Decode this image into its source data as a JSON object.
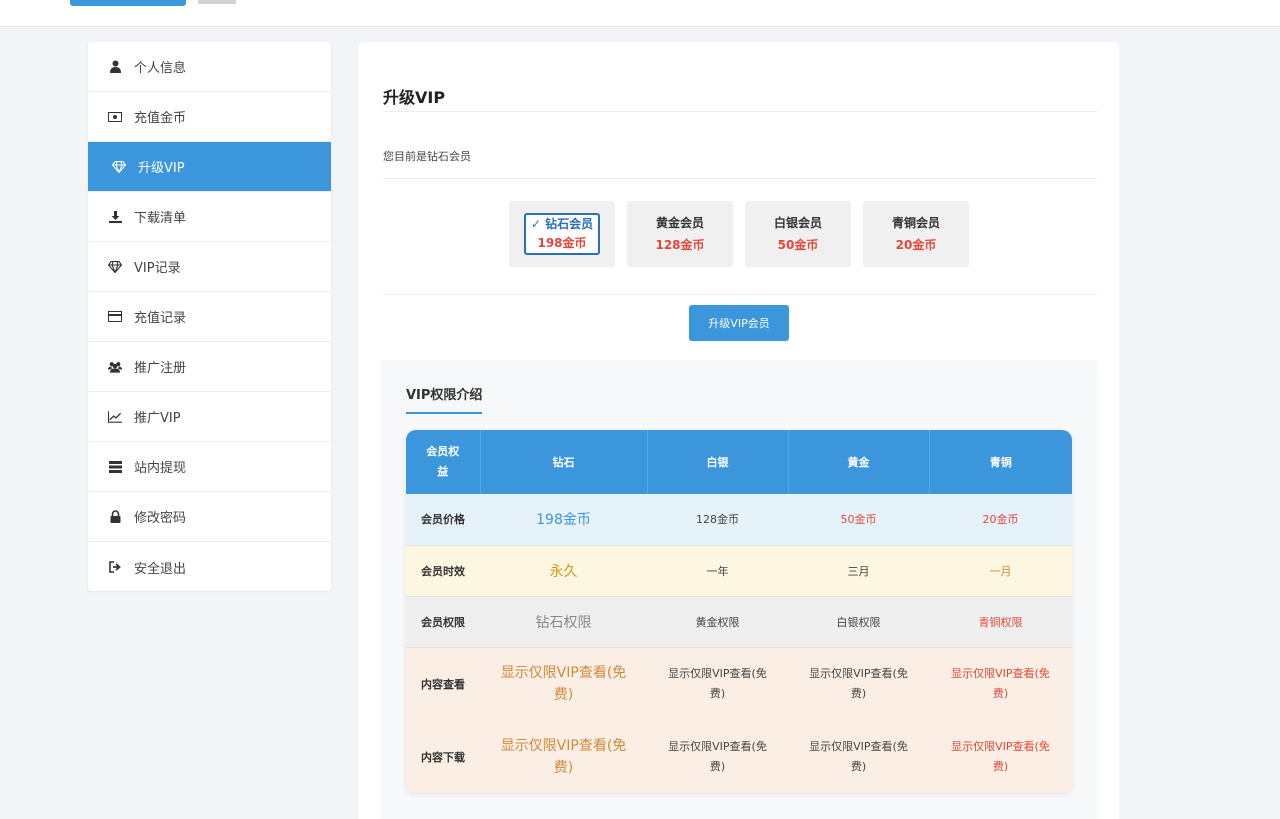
{
  "sidebar": {
    "items": [
      {
        "label": "个人信息",
        "icon": "user-icon",
        "active": false
      },
      {
        "label": "充值金币",
        "icon": "money-icon",
        "active": false
      },
      {
        "label": "升级VIP",
        "icon": "diamond-icon",
        "active": true
      },
      {
        "label": "下载清单",
        "icon": "download-icon",
        "active": false
      },
      {
        "label": "VIP记录",
        "icon": "diamond-icon",
        "active": false
      },
      {
        "label": "充值记录",
        "icon": "credit-card-icon",
        "active": false
      },
      {
        "label": "推广注册",
        "icon": "users-icon",
        "active": false
      },
      {
        "label": "推广VIP",
        "icon": "line-chart-icon",
        "active": false
      },
      {
        "label": "站内提现",
        "icon": "server-icon",
        "active": false
      },
      {
        "label": "修改密码",
        "icon": "lock-icon",
        "active": false
      },
      {
        "label": "安全退出",
        "icon": "sign-out-icon",
        "active": false
      }
    ]
  },
  "main": {
    "title": "升级VIP",
    "status": "您目前是钻石会员",
    "tiers": [
      {
        "name": "✓ 钻石会员",
        "price": "198金币",
        "selected": true
      },
      {
        "name": "黄金会员",
        "price": "128金币",
        "selected": false
      },
      {
        "name": "白银会员",
        "price": "50金币",
        "selected": false
      },
      {
        "name": "青铜会员",
        "price": "20金币",
        "selected": false
      }
    ],
    "upgrade_button": "升级VIP会员",
    "intro_title": "VIP权限介绍"
  },
  "table": {
    "headers": [
      "会员权益",
      "钻石",
      "白银",
      "黄金",
      "青铜"
    ],
    "rows": {
      "price": {
        "label": "会员价格",
        "cells": [
          "198金币",
          "128金币",
          "50金币",
          "20金币"
        ]
      },
      "time": {
        "label": "会员时效",
        "cells": [
          "永久",
          "一年",
          "三月",
          "一月"
        ]
      },
      "perm": {
        "label": "会员权限",
        "cells": [
          "钻石权限",
          "黄金权限",
          "白银权限",
          "青铜权限"
        ]
      },
      "view": {
        "label": "内容查看",
        "cells": [
          "显示仅限VIP查看(免费)",
          "显示仅限VIP查看(免费)",
          "显示仅限VIP查看(免费)",
          "显示仅限VIP查看(免费)"
        ]
      },
      "download": {
        "label": "内容下载",
        "cells": [
          "显示仅限VIP查看(免费)",
          "显示仅限VIP查看(免费)",
          "显示仅限VIP查看(免费)",
          "显示仅限VIP查看(免费)"
        ]
      }
    }
  },
  "colors": {
    "accent": "#3b96dc",
    "price_red": "#e0483a",
    "gold": "#d49a16",
    "orange": "#d08a3b"
  }
}
